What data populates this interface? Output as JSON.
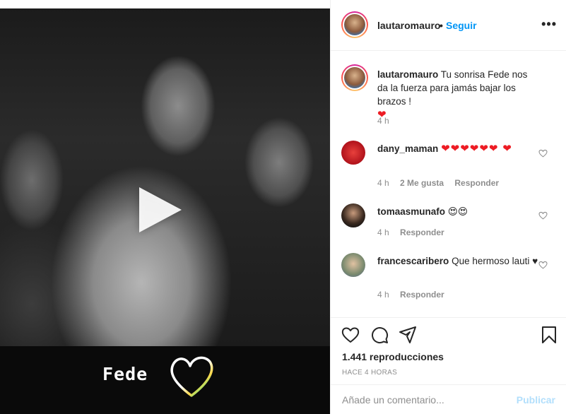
{
  "post": {
    "username": "lautaromauro",
    "follow_label": "Seguir",
    "separator": "•",
    "more_label": "•••",
    "overlay_text": "Fede"
  },
  "caption": {
    "username": "lautaromauro",
    "text": "Tu sonrisa Fede nos da la fuerza para jamás bajar los brazos !",
    "emoji": "❤",
    "time": "4 h"
  },
  "comments": [
    {
      "username": "dany_maman",
      "text": "❤❤❤❤❤❤ ❤",
      "time": "4 h",
      "likes": "2 Me gusta",
      "reply": "Responder"
    },
    {
      "username": "tomaasmunafo",
      "text": "😍😍",
      "time": "4 h",
      "reply": "Responder"
    },
    {
      "username": "francescaribero",
      "text": "Que hermoso lauti ♥",
      "time": "4 h",
      "reply": "Responder"
    }
  ],
  "stats": {
    "views": "1.441 reproducciones",
    "posted": "HACE 4 HORAS"
  },
  "composer": {
    "placeholder": "Añade un comentario...",
    "publish_label": "Publicar"
  },
  "colors": {
    "link_blue": "#0095f6",
    "publish_disabled": "#b2dffc",
    "heart_red": "#ed1c24",
    "muted": "#8e8e8e"
  },
  "icons": [
    "play-icon",
    "heart-icon",
    "comment-icon",
    "share-icon",
    "bookmark-icon",
    "more-icon"
  ]
}
